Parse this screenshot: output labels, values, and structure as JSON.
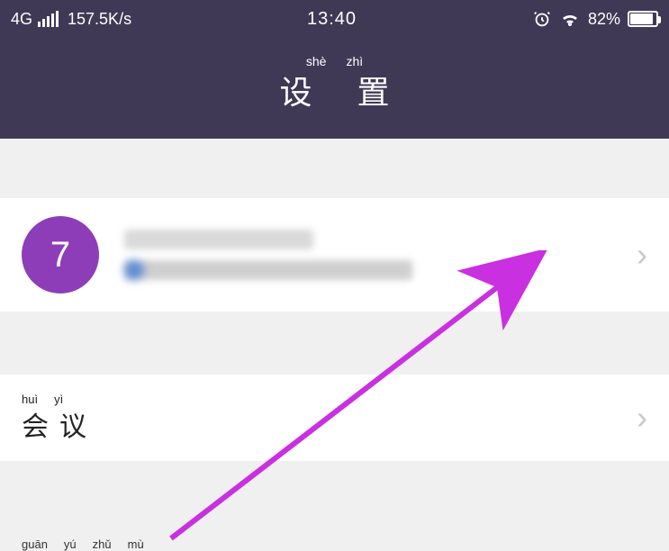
{
  "status": {
    "network_type": "4G",
    "net_speed": "157.5K/s",
    "time": "13:40",
    "battery_pct": "82%"
  },
  "header": {
    "pinyin1": "shè",
    "pinyin2": "zhì",
    "title": "设 置"
  },
  "profile": {
    "avatar_text": "7"
  },
  "items": {
    "meeting": {
      "pinyin1": "huì",
      "pinyin2": "yì",
      "label": "会议"
    }
  },
  "bottom_pinyin": {
    "p1": "guān",
    "p2": "yú",
    "p3": "zhǔ",
    "p4": "mù"
  }
}
